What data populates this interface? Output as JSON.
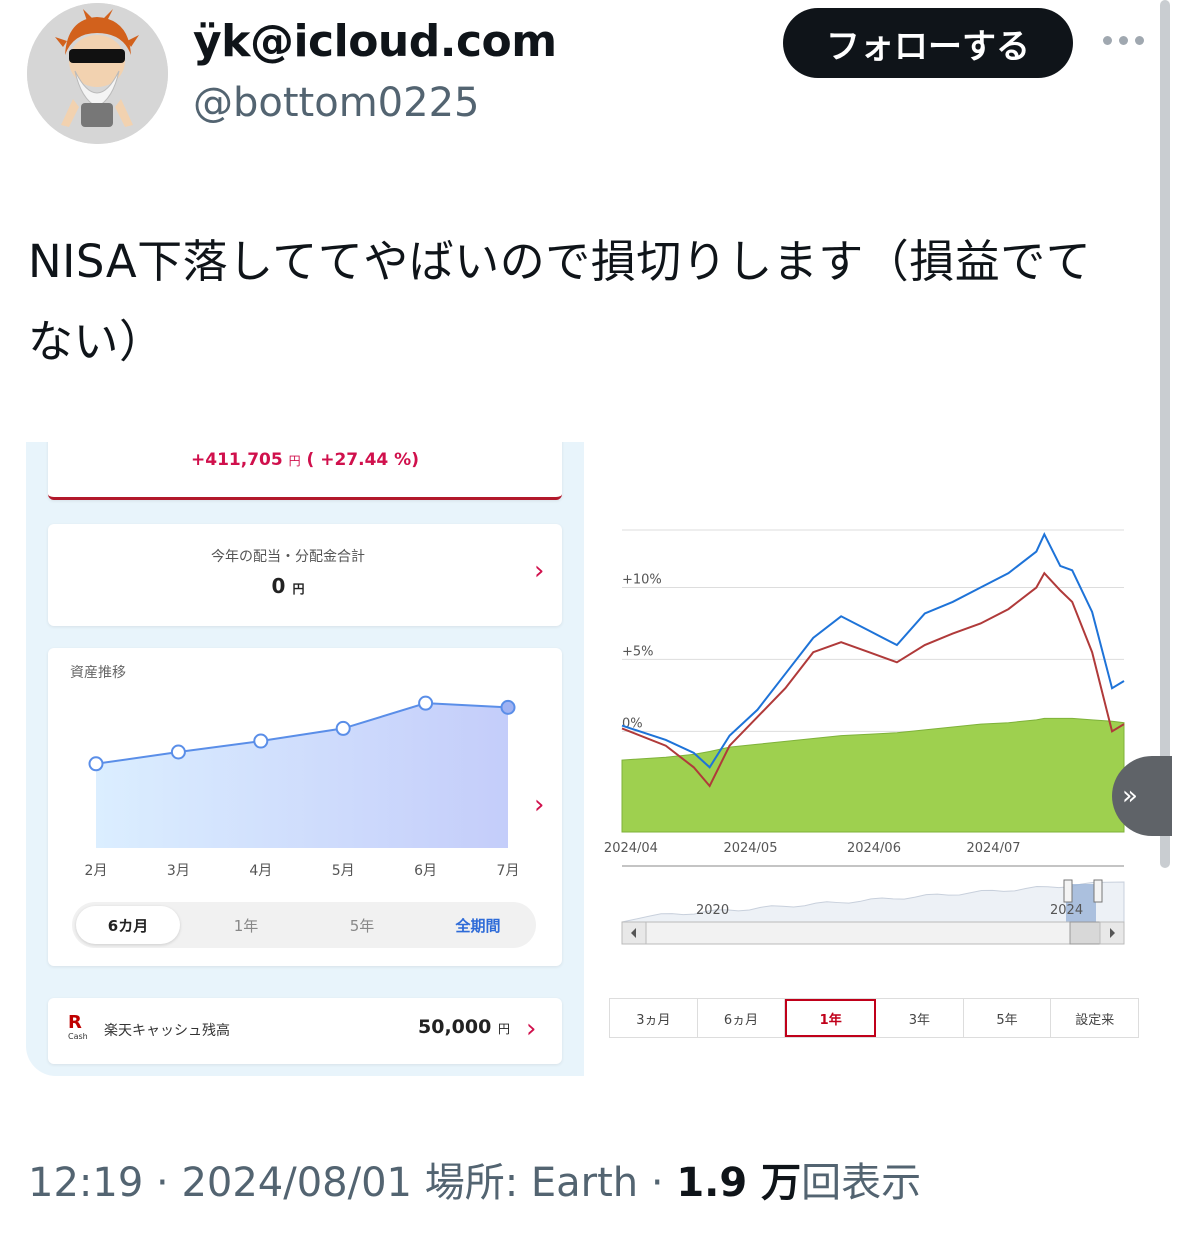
{
  "profile": {
    "display_name": "ÿk@icloud.com",
    "handle": "@bottom0225",
    "follow_label": "フォローする"
  },
  "tweet": {
    "text": "NISA下落しててやばいので損切りします（損益でてない）"
  },
  "app_screen": {
    "gain_amount": "+411,705",
    "gain_unit": "円",
    "gain_percent": "( +27.44 %)",
    "dividend_label": "今年の配当・分配金合計",
    "dividend_value": "0",
    "dividend_unit": "円",
    "asset_title": "資産推移",
    "periods": [
      "6カ月",
      "1年",
      "5年",
      "全期間"
    ],
    "cash_logo": "R",
    "cash_logo_sub": "Cash",
    "cash_label": "楽天キャッシュ残高",
    "cash_value": "50,000",
    "cash_unit": "円"
  },
  "fund_screen": {
    "tabs": [
      "3ヵ月",
      "6ヵ月",
      "1年",
      "3年",
      "5年",
      "設定来"
    ],
    "active_tab": "1年",
    "navigator_labels": [
      "2020",
      "2024"
    ],
    "next_label": "»"
  },
  "chart_data": [
    {
      "type": "area",
      "title": "資産推移",
      "categories": [
        "2月",
        "3月",
        "4月",
        "5月",
        "6月",
        "7月"
      ],
      "values": [
        100,
        114,
        127,
        142,
        172,
        167
      ],
      "colors": {
        "line": "#4a90e2",
        "fill": "#c9d8fb"
      }
    },
    {
      "type": "line",
      "x": [
        "2024/03/28",
        "2024/04/08",
        "2024/04/15",
        "2024/04/19",
        "2024/04/24",
        "2024/05/01",
        "2024/05/08",
        "2024/05/15",
        "2024/05/22",
        "2024/05/29",
        "2024/06/05",
        "2024/06/12",
        "2024/06/19",
        "2024/06/26",
        "2024/07/03",
        "2024/07/10",
        "2024/07/12",
        "2024/07/16",
        "2024/07/19",
        "2024/07/24",
        "2024/07/29",
        "2024/08/01"
      ],
      "xticks": [
        "2024/04",
        "2024/05",
        "2024/06",
        "2024/07"
      ],
      "yticks": [
        "0%",
        "+5%",
        "+10%"
      ],
      "ylim": [
        -7,
        14
      ],
      "series": [
        {
          "color": "#1e73d8",
          "values": [
            0.4,
            -0.6,
            -1.5,
            -2.5,
            -0.3,
            1.5,
            4.0,
            6.5,
            8.0,
            7.0,
            6.0,
            8.2,
            9.0,
            10.0,
            11.0,
            12.5,
            13.7,
            11.5,
            11.2,
            8.3,
            3.0,
            3.5
          ]
        },
        {
          "color": "#b03a3a",
          "values": [
            0.2,
            -1.0,
            -2.5,
            -3.8,
            -1.0,
            1.0,
            3.0,
            5.5,
            6.2,
            5.5,
            4.8,
            6.0,
            6.8,
            7.5,
            8.5,
            10.0,
            11.0,
            9.8,
            9.0,
            5.5,
            0.0,
            0.5
          ]
        },
        {
          "color": "#9ed04f",
          "area": true,
          "values": [
            -2.0,
            -1.8,
            -1.6,
            -1.4,
            -1.1,
            -0.9,
            -0.7,
            -0.5,
            -0.3,
            -0.2,
            -0.1,
            0.1,
            0.3,
            0.5,
            0.6,
            0.8,
            0.9,
            0.9,
            0.9,
            0.8,
            0.7,
            0.6
          ]
        }
      ]
    }
  ],
  "footer": {
    "time": "12:19",
    "date": "2024/08/01",
    "location": "場所: Earth",
    "views_count": "1.9 万",
    "views_label": "回表示"
  }
}
